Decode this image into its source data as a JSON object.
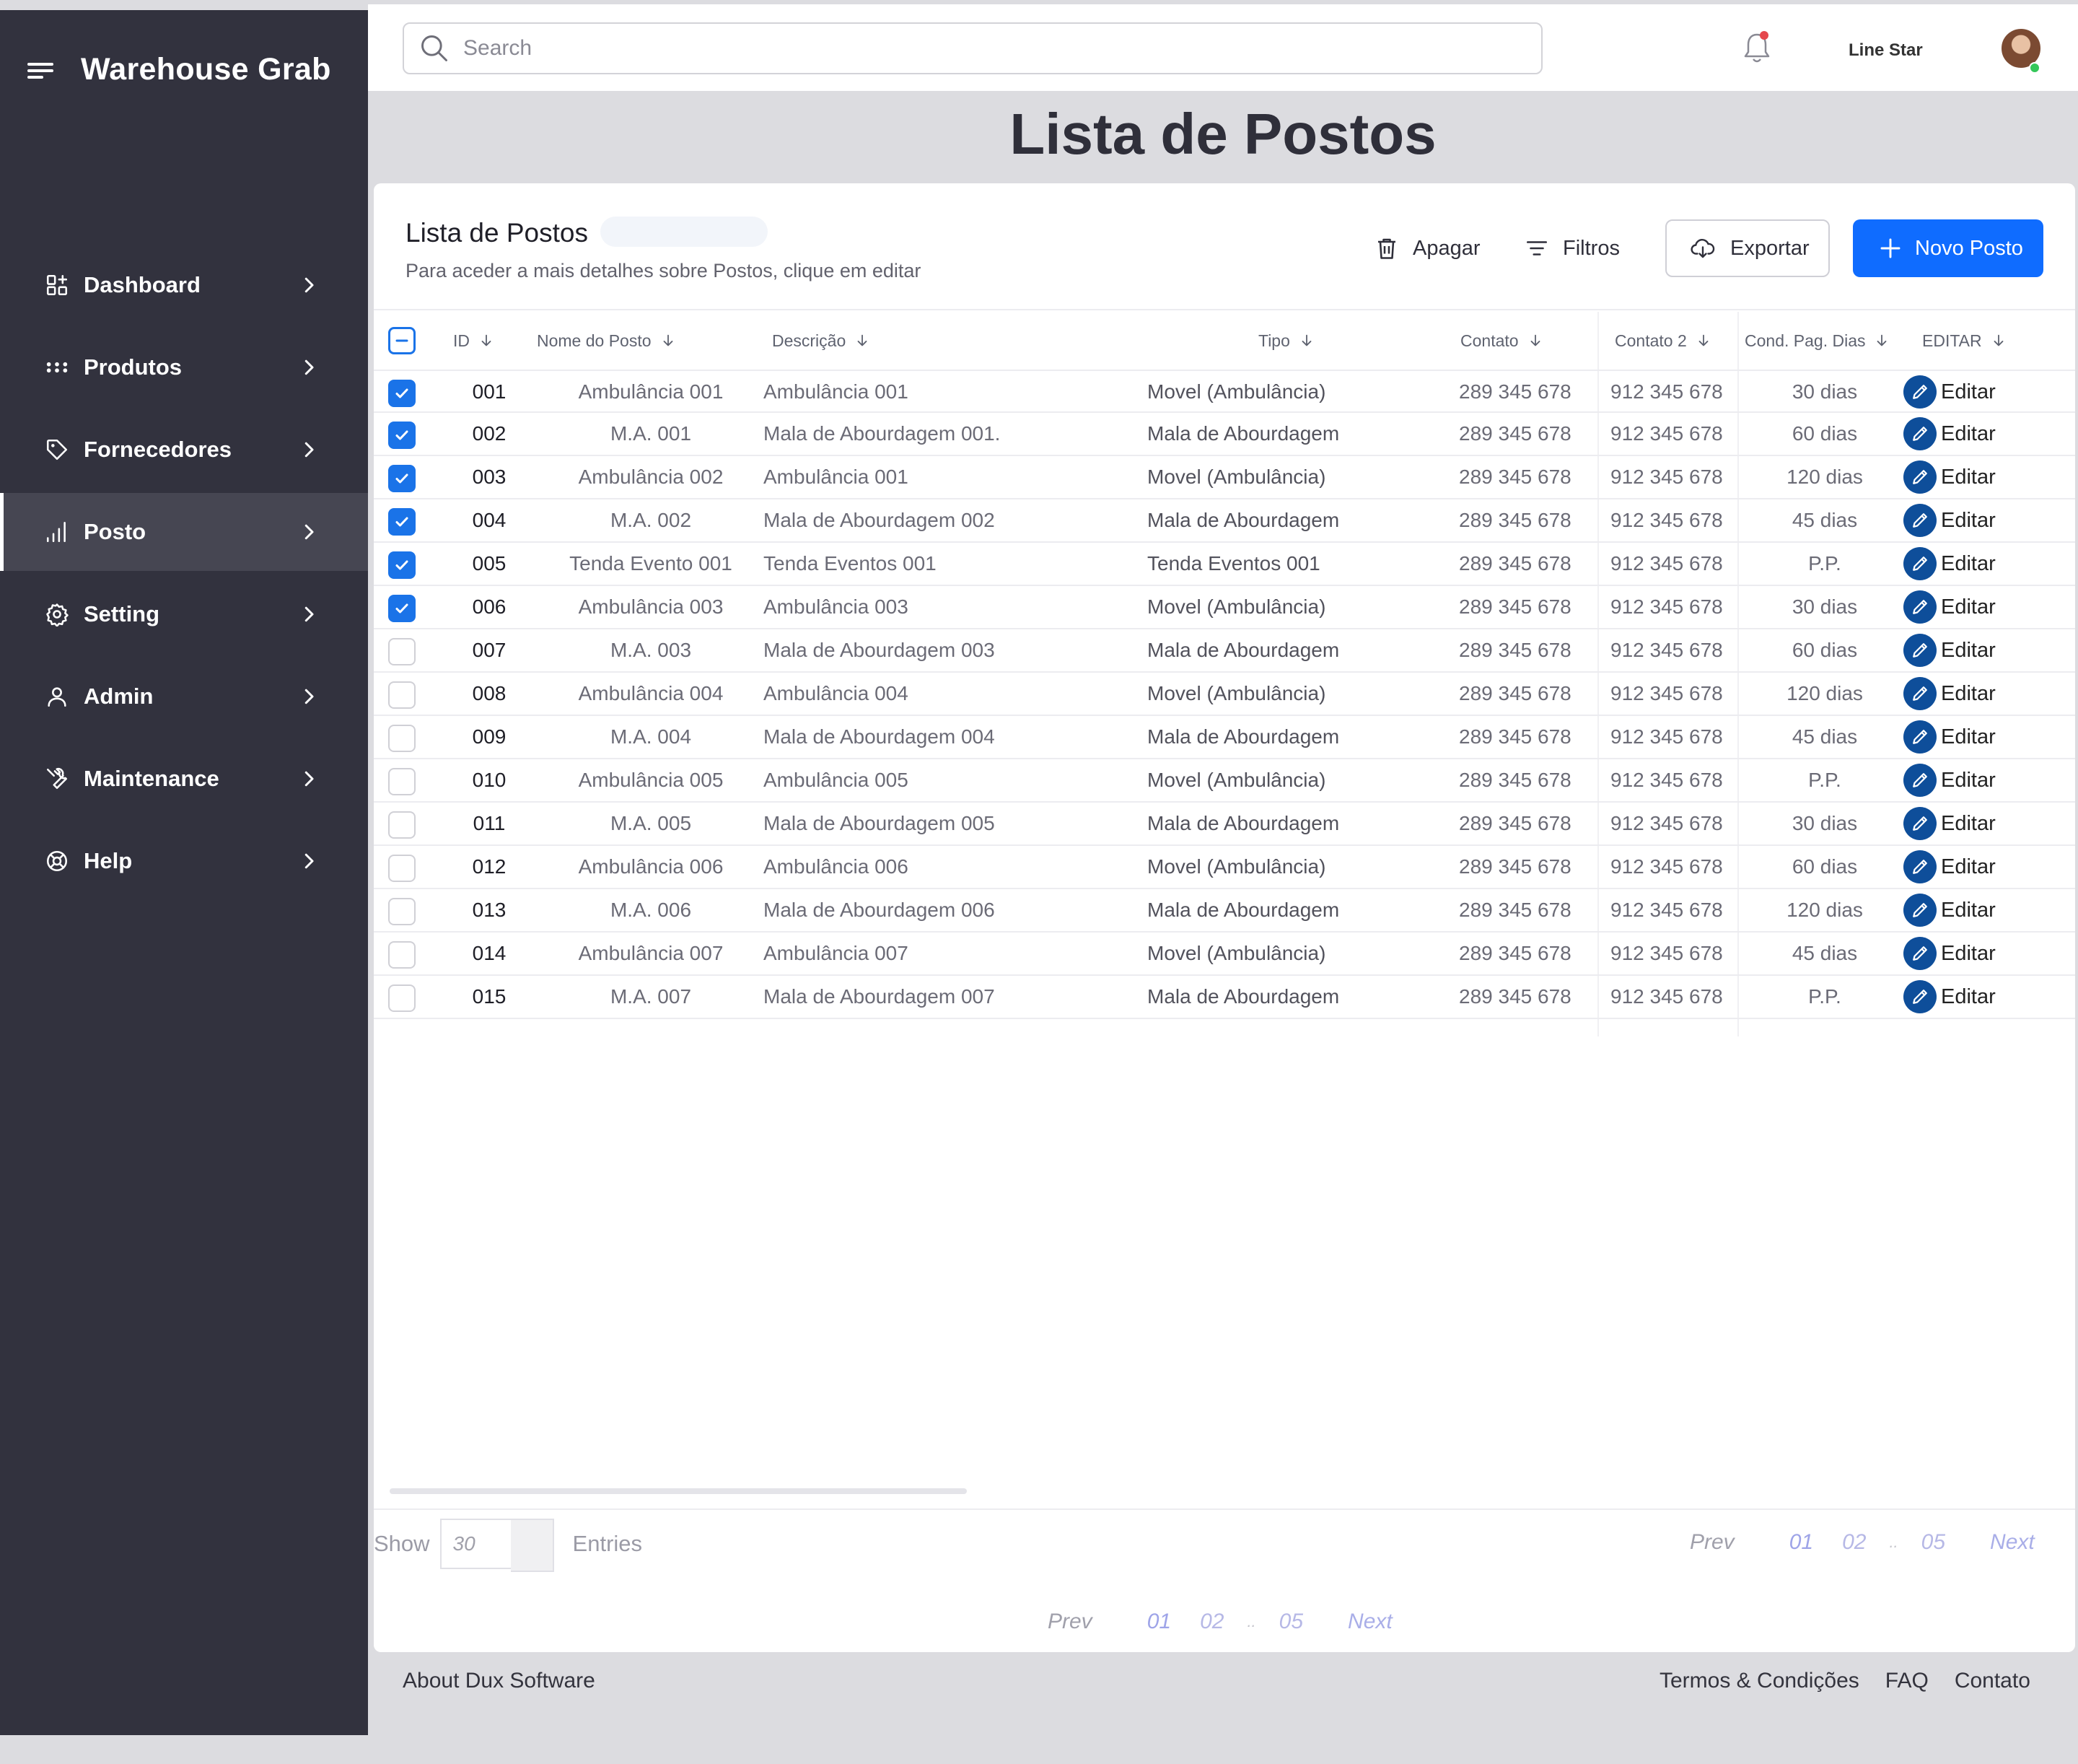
{
  "app": {
    "name": "Warehouse Grab"
  },
  "sidebar": {
    "items": [
      {
        "label": "Dashboard",
        "icon": "dashboard-icon",
        "active": false
      },
      {
        "label": "Produtos",
        "icon": "grid-dots-icon",
        "active": false
      },
      {
        "label": "Fornecedores",
        "icon": "tag-icon",
        "active": false
      },
      {
        "label": "Posto",
        "icon": "bar-chart-icon",
        "active": true
      },
      {
        "label": "Setting",
        "icon": "gear-icon",
        "active": false
      },
      {
        "label": "Admin",
        "icon": "user-icon",
        "active": false
      },
      {
        "label": "Maintenance",
        "icon": "wrench-icon",
        "active": false
      },
      {
        "label": "Help",
        "icon": "help-icon",
        "active": false
      }
    ]
  },
  "topbar": {
    "search_placeholder": "Search",
    "user_name": "Line Star",
    "has_notification": true
  },
  "page": {
    "title": "Lista de Postos"
  },
  "card": {
    "title": "Lista de Postos",
    "subtitle": "Para aceder a mais detalhes sobre Postos, clique em editar",
    "actions": {
      "delete": "Apagar",
      "filters": "Filtros",
      "export": "Exportar",
      "new": "Novo Posto"
    }
  },
  "table": {
    "columns": [
      "ID",
      "Nome do Posto",
      "Descrição",
      "Tipo",
      "Contato",
      "Contato 2",
      "Cond. Pag. Dias",
      "EDITAR"
    ],
    "edit_label": "Editar",
    "rows": [
      {
        "checked": true,
        "id": "001",
        "nome": "Ambulância 001",
        "descricao": "Ambulância 001",
        "tipo": "Movel (Ambulância)",
        "contato": "289 345 678",
        "contato2": "912 345 678",
        "cond": "30 dias"
      },
      {
        "checked": true,
        "id": "002",
        "nome": "M.A. 001",
        "descricao": "Mala de Abourdagem 001.",
        "tipo": "Mala de Abourdagem",
        "contato": "289 345 678",
        "contato2": "912 345 678",
        "cond": "60 dias"
      },
      {
        "checked": true,
        "id": "003",
        "nome": "Ambulância 002",
        "descricao": "Ambulância 001",
        "tipo": "Movel (Ambulância)",
        "contato": "289 345 678",
        "contato2": "912 345 678",
        "cond": "120 dias"
      },
      {
        "checked": true,
        "id": "004",
        "nome": "M.A. 002",
        "descricao": "Mala de Abourdagem 002",
        "tipo": "Mala de Abourdagem",
        "contato": "289 345 678",
        "contato2": "912 345 678",
        "cond": "45 dias"
      },
      {
        "checked": true,
        "id": "005",
        "nome": "Tenda Evento 001",
        "descricao": "Tenda Eventos 001",
        "tipo": "Tenda Eventos 001",
        "contato": "289 345 678",
        "contato2": "912 345 678",
        "cond": "P.P."
      },
      {
        "checked": true,
        "id": "006",
        "nome": "Ambulância 003",
        "descricao": "Ambulância 003",
        "tipo": "Movel (Ambulância)",
        "contato": "289 345 678",
        "contato2": "912 345 678",
        "cond": "30 dias"
      },
      {
        "checked": false,
        "id": "007",
        "nome": "M.A. 003",
        "descricao": "Mala de Abourdagem 003",
        "tipo": "Mala de Abourdagem",
        "contato": "289 345 678",
        "contato2": "912 345 678",
        "cond": "60 dias"
      },
      {
        "checked": false,
        "id": "008",
        "nome": "Ambulância 004",
        "descricao": "Ambulância 004",
        "tipo": "Movel (Ambulância)",
        "contato": "289 345 678",
        "contato2": "912 345 678",
        "cond": "120 dias"
      },
      {
        "checked": false,
        "id": "009",
        "nome": "M.A. 004",
        "descricao": "Mala de Abourdagem 004",
        "tipo": "Mala de Abourdagem",
        "contato": "289 345 678",
        "contato2": "912 345 678",
        "cond": "45 dias"
      },
      {
        "checked": false,
        "id": "010",
        "nome": "Ambulância 005",
        "descricao": "Ambulância 005",
        "tipo": "Movel (Ambulância)",
        "contato": "289 345 678",
        "contato2": "912 345 678",
        "cond": "P.P."
      },
      {
        "checked": false,
        "id": "011",
        "nome": "M.A. 005",
        "descricao": "Mala de Abourdagem 005",
        "tipo": "Mala de Abourdagem",
        "contato": "289 345 678",
        "contato2": "912 345 678",
        "cond": "30 dias"
      },
      {
        "checked": false,
        "id": "012",
        "nome": "Ambulância 006",
        "descricao": "Ambulância 006",
        "tipo": "Movel (Ambulância)",
        "contato": "289 345 678",
        "contato2": "912 345 678",
        "cond": "60 dias"
      },
      {
        "checked": false,
        "id": "013",
        "nome": "M.A. 006",
        "descricao": "Mala de Abourdagem 006",
        "tipo": "Mala de Abourdagem",
        "contato": "289 345 678",
        "contato2": "912 345 678",
        "cond": "120 dias"
      },
      {
        "checked": false,
        "id": "014",
        "nome": "Ambulância 007",
        "descricao": "Ambulância 007",
        "tipo": "Movel (Ambulância)",
        "contato": "289 345 678",
        "contato2": "912 345 678",
        "cond": "45 dias"
      },
      {
        "checked": false,
        "id": "015",
        "nome": "M.A. 007",
        "descricao": "Mala de Abourdagem 007",
        "tipo": "Mala de Abourdagem",
        "contato": "289 345 678",
        "contato2": "912 345 678",
        "cond": "P.P."
      }
    ]
  },
  "footer_controls": {
    "show_label": "Show",
    "entries_value": "30",
    "entries_label": "Entries",
    "pagination": {
      "prev": "Prev",
      "pages": [
        "01",
        "02",
        "05"
      ],
      "dots": "..",
      "next": "Next",
      "current": "01"
    }
  },
  "footer": {
    "about": "About Dux Software",
    "links": [
      "Termos & Condições",
      "FAQ",
      "Contato"
    ]
  },
  "colors": {
    "sidebar_bg": "#32323e",
    "primary": "#0f6cff",
    "checkbox": "#1a73e8",
    "edit_icon": "#0e4e9a"
  }
}
